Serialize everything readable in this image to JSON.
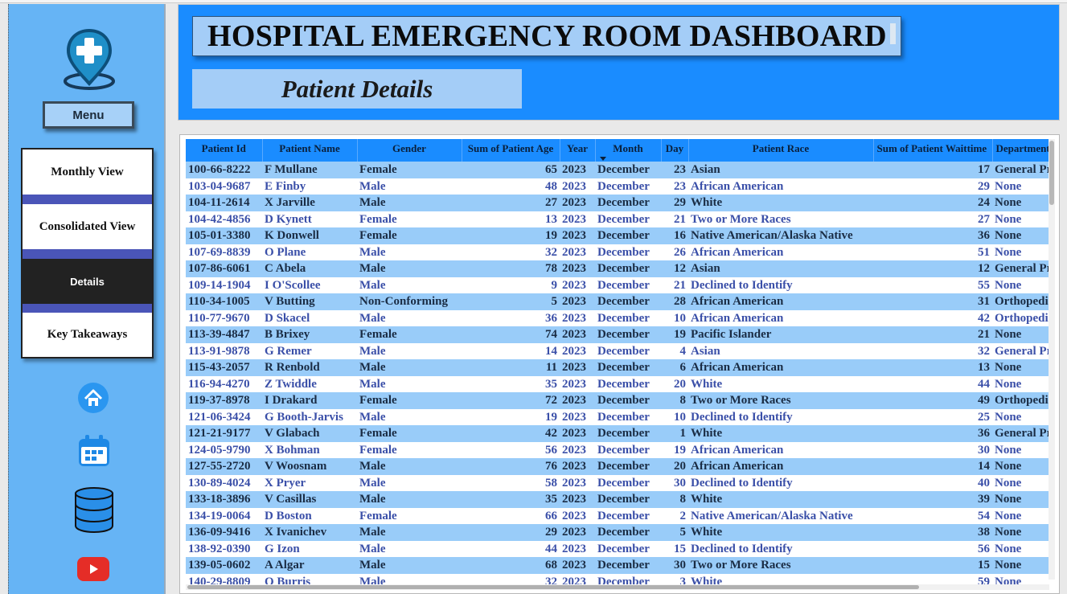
{
  "header": {
    "title": "HOSPITAL EMERGENCY ROOM DASHBOARD",
    "subtitle": "Patient Details"
  },
  "sidebar": {
    "menu_label": "Menu",
    "nav": [
      {
        "label": "Monthly View",
        "active": false
      },
      {
        "label": "Consolidated View",
        "active": false
      },
      {
        "label": "Details",
        "active": true
      },
      {
        "label": "Key Takeaways",
        "active": false
      }
    ],
    "icons": [
      "home-icon",
      "calendar-icon",
      "database-icon",
      "youtube-icon"
    ]
  },
  "colors": {
    "header_bg": "#1a8cff",
    "sidebar_bg": "#66b4f5",
    "row_odd": "#99ccf9",
    "row_even": "#ffffff",
    "youtube_red": "#e52d27"
  },
  "table": {
    "columns": [
      "Patient Id",
      "Patient Name",
      "Gender",
      "Sum of Patient Age",
      "Year",
      "Month",
      "Day",
      "Patient Race",
      "Sum of Patient Waittime",
      "Department Referral"
    ],
    "sorted_column": "Month",
    "rows": [
      [
        "100-66-8222",
        "F Mullane",
        "Female",
        "65",
        "2023",
        "December",
        "23",
        "Asian",
        "17",
        "General Practice"
      ],
      [
        "103-04-9687",
        "E Finby",
        "Male",
        "48",
        "2023",
        "December",
        "23",
        "African American",
        "29",
        "None"
      ],
      [
        "104-11-2614",
        "X Jarville",
        "Male",
        "27",
        "2023",
        "December",
        "29",
        "White",
        "24",
        "None"
      ],
      [
        "104-42-4856",
        "D Kynett",
        "Female",
        "13",
        "2023",
        "December",
        "21",
        "Two or More Races",
        "27",
        "None"
      ],
      [
        "105-01-3380",
        "K Donwell",
        "Female",
        "19",
        "2023",
        "December",
        "16",
        "Native American/Alaska Native",
        "36",
        "None"
      ],
      [
        "107-69-8839",
        "O Plane",
        "Male",
        "32",
        "2023",
        "December",
        "26",
        "African American",
        "51",
        "None"
      ],
      [
        "107-86-6061",
        "C Abela",
        "Male",
        "78",
        "2023",
        "December",
        "12",
        "Asian",
        "12",
        "General Practice"
      ],
      [
        "109-14-1904",
        "I O'Scollee",
        "Male",
        "9",
        "2023",
        "December",
        "21",
        "Declined to Identify",
        "55",
        "None"
      ],
      [
        "110-34-1005",
        "V Butting",
        "Non-Conforming",
        "5",
        "2023",
        "December",
        "28",
        "African American",
        "31",
        "Orthopedics"
      ],
      [
        "110-77-9670",
        "D Skacel",
        "Male",
        "36",
        "2023",
        "December",
        "10",
        "African American",
        "42",
        "Orthopedics"
      ],
      [
        "113-39-4847",
        "B Brixey",
        "Female",
        "74",
        "2023",
        "December",
        "19",
        "Pacific Islander",
        "21",
        "None"
      ],
      [
        "113-91-9878",
        "G Remer",
        "Male",
        "14",
        "2023",
        "December",
        "4",
        "Asian",
        "32",
        "General Practice"
      ],
      [
        "115-43-2057",
        "R Renbold",
        "Male",
        "11",
        "2023",
        "December",
        "6",
        "African American",
        "13",
        "None"
      ],
      [
        "116-94-4270",
        "Z Twiddle",
        "Male",
        "35",
        "2023",
        "December",
        "20",
        "White",
        "44",
        "None"
      ],
      [
        "119-37-8978",
        "I Drakard",
        "Female",
        "72",
        "2023",
        "December",
        "8",
        "Two or More Races",
        "49",
        "Orthopedics"
      ],
      [
        "121-06-3424",
        "G Booth-Jarvis",
        "Male",
        "19",
        "2023",
        "December",
        "10",
        "Declined to Identify",
        "25",
        "None"
      ],
      [
        "121-21-9177",
        "V Glabach",
        "Female",
        "42",
        "2023",
        "December",
        "1",
        "White",
        "36",
        "General Practice"
      ],
      [
        "124-05-9790",
        "X Bohman",
        "Female",
        "56",
        "2023",
        "December",
        "19",
        "African American",
        "30",
        "None"
      ],
      [
        "127-55-2720",
        "V Woosnam",
        "Male",
        "76",
        "2023",
        "December",
        "20",
        "African American",
        "14",
        "None"
      ],
      [
        "130-89-4024",
        "X Pryer",
        "Male",
        "58",
        "2023",
        "December",
        "30",
        "Declined to Identify",
        "40",
        "None"
      ],
      [
        "133-18-3896",
        "V Casillas",
        "Male",
        "35",
        "2023",
        "December",
        "8",
        "White",
        "39",
        "None"
      ],
      [
        "134-19-0064",
        "D Boston",
        "Female",
        "66",
        "2023",
        "December",
        "2",
        "Native American/Alaska Native",
        "54",
        "None"
      ],
      [
        "136-09-9416",
        "X Ivanichev",
        "Male",
        "29",
        "2023",
        "December",
        "5",
        "White",
        "38",
        "None"
      ],
      [
        "138-92-0390",
        "G Izon",
        "Male",
        "44",
        "2023",
        "December",
        "15",
        "Declined to Identify",
        "56",
        "None"
      ],
      [
        "139-05-0602",
        "A Algar",
        "Male",
        "68",
        "2023",
        "December",
        "30",
        "Two or More Races",
        "15",
        "None"
      ],
      [
        "140-29-8809",
        "O Burris",
        "Male",
        "32",
        "2023",
        "December",
        "3",
        "White",
        "59",
        "None"
      ]
    ]
  }
}
